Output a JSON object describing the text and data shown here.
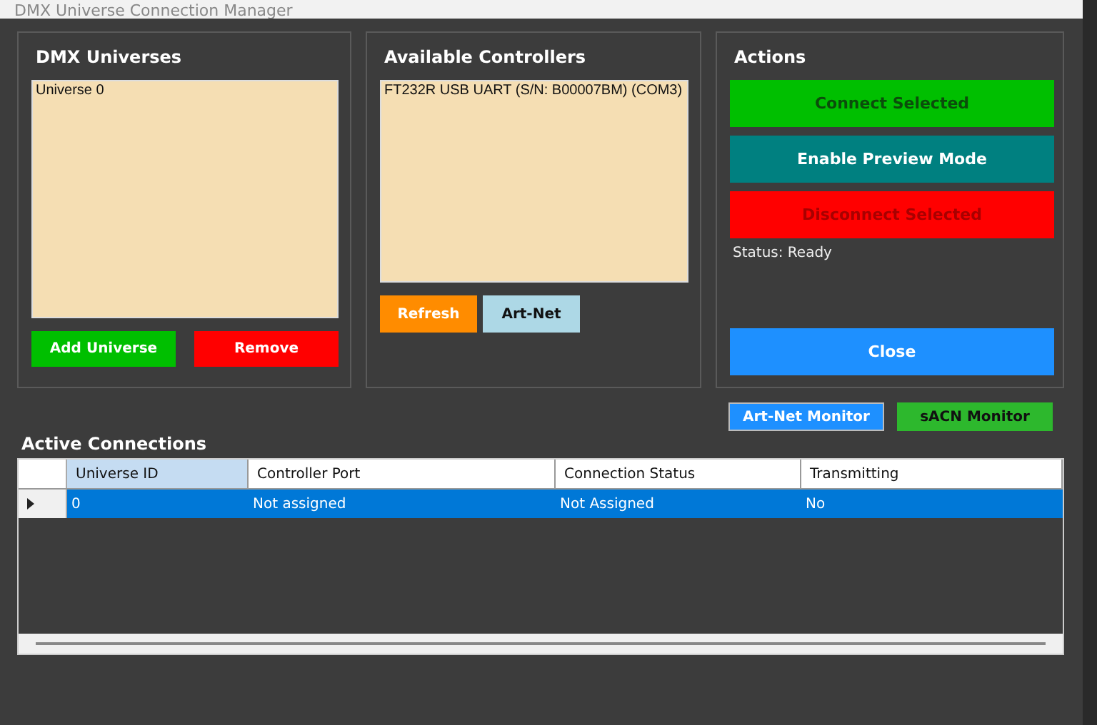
{
  "window": {
    "title": "DMX Universe Connection Manager"
  },
  "universes": {
    "title": "DMX Universes",
    "items": [
      {
        "label": "Universe 0",
        "selected": false
      }
    ],
    "buttons": [
      {
        "label": "Add Universe",
        "kind": "green"
      },
      {
        "label": "Remove",
        "kind": "red"
      }
    ]
  },
  "controllers": {
    "title": "Available Controllers",
    "items": [
      {
        "label": "FT232R USB UART (S/N: B00007BM) (COM3)",
        "selected": false
      }
    ],
    "buttons": [
      {
        "label": "Refresh",
        "kind": "orange"
      },
      {
        "label": "Art-Net",
        "kind": "lightblue"
      }
    ]
  },
  "actions": {
    "title": "Actions",
    "buttons": [
      {
        "label": "Connect Selected",
        "kind": "green"
      },
      {
        "label": "Enable Preview Mode",
        "kind": "teal"
      },
      {
        "label": "Disconnect Selected",
        "kind": "red"
      }
    ],
    "status": "Status: Ready",
    "close": "Close"
  },
  "monitors": [
    {
      "label": "Art-Net Monitor",
      "kind": "blue"
    },
    {
      "label": "sACN Monitor",
      "kind": "green"
    }
  ],
  "connections": {
    "title": "Active Connections",
    "columns": [
      "Universe ID",
      "Controller Port",
      "Connection Status",
      "Transmitting"
    ],
    "rows": [
      {
        "cells": [
          "0",
          "Not assigned",
          "Not Assigned",
          "No"
        ],
        "selected": true
      }
    ]
  }
}
